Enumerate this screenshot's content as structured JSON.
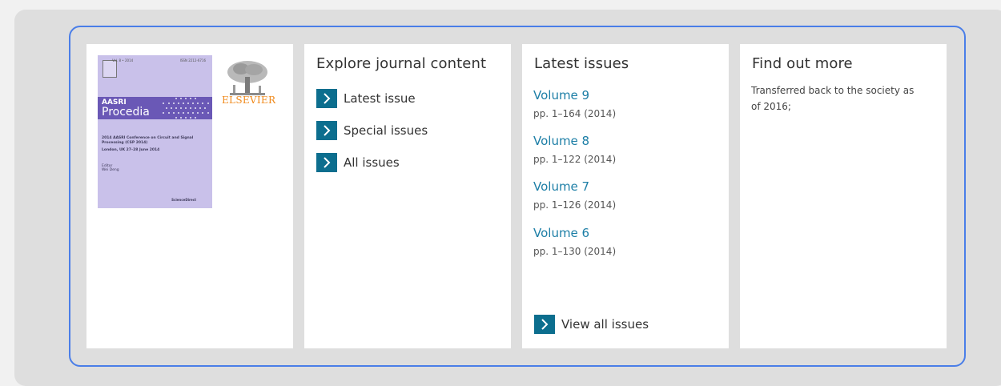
{
  "cover": {
    "journal_line1": "AASRI",
    "journal_line2": "Procedia",
    "volume_line": "Vol. 8 • 2014",
    "issn_line": "ISSN 2212-6716",
    "conference_title": "2014 AASRI Conference on Circuit and Signal Processing (CSP 2014)",
    "location_dates": "London, UK 27–28 June 2014",
    "editor_label": "Editor",
    "editor_name": "Wei Deng",
    "footer_mark": "ScienceDirect",
    "publisher_name": "ELSEVIER"
  },
  "explore": {
    "title": "Explore journal content",
    "links": [
      {
        "label": "Latest issue"
      },
      {
        "label": "Special issues"
      },
      {
        "label": "All issues"
      }
    ]
  },
  "latest": {
    "title": "Latest issues",
    "issues": [
      {
        "volume": "Volume 9",
        "pages": "pp. 1–164 (2014)"
      },
      {
        "volume": "Volume 8",
        "pages": "pp. 1–122 (2014)"
      },
      {
        "volume": "Volume 7",
        "pages": "pp. 1–126 (2014)"
      },
      {
        "volume": "Volume 6",
        "pages": "pp. 1–130 (2014)"
      }
    ],
    "view_all": "View all issues"
  },
  "find_out_more": {
    "title": "Find out more",
    "text": "Transferred back to the society as of 2016;"
  },
  "colors": {
    "accent": "#0c6e8e",
    "link": "#1c7ea6",
    "frame": "#4a7ee8",
    "cover": "#c9c1ea",
    "cover_band": "#6a58b6",
    "publisher": "#f08a1c"
  }
}
